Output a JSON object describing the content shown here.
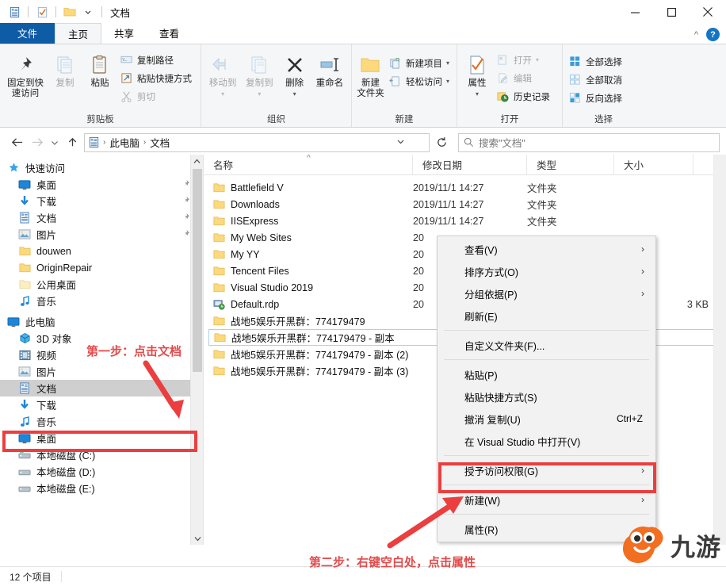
{
  "window": {
    "title": "文档",
    "minimize_label": "最小化",
    "maximize_label": "最大化",
    "close_label": "关闭",
    "help_label": "?",
    "collapse_ribbon_label": "^"
  },
  "quick_access_toolbar": [
    {
      "name": "documents-icon",
      "label": "文档"
    },
    {
      "name": "properties-icon",
      "label": "属性"
    },
    {
      "name": "new-folder-icon",
      "label": "新建文件夹"
    },
    {
      "name": "customize-icon",
      "label": "▾"
    }
  ],
  "tabs": [
    {
      "label": "文件",
      "kind": "file"
    },
    {
      "label": "主页",
      "kind": "active"
    },
    {
      "label": "共享",
      "kind": "normal"
    },
    {
      "label": "查看",
      "kind": "normal"
    }
  ],
  "ribbon": {
    "groups": [
      {
        "label": "剪贴板",
        "big": [
          {
            "label1": "固定到快",
            "label2": "速访问",
            "icon": "pin-icon",
            "dim": false
          },
          {
            "label1": "复制",
            "label2": "",
            "icon": "copy-icon",
            "dim": true
          },
          {
            "label1": "粘贴",
            "label2": "",
            "icon": "paste-icon",
            "dim": false
          }
        ],
        "small": [
          {
            "label": "复制路径",
            "icon": "copy-path-icon",
            "dim": false
          },
          {
            "label": "粘贴快捷方式",
            "icon": "paste-shortcut-icon",
            "dim": false
          },
          {
            "label": "剪切",
            "icon": "cut-icon",
            "dim": true
          }
        ]
      },
      {
        "label": "组织",
        "big": [
          {
            "label1": "移动到",
            "label2": "",
            "icon": "move-to-icon",
            "dim": true,
            "caret": true
          },
          {
            "label1": "复制到",
            "label2": "",
            "icon": "copy-to-icon",
            "dim": true,
            "caret": true
          },
          {
            "label1": "删除",
            "label2": "",
            "icon": "delete-icon",
            "dim": false,
            "caret": true
          },
          {
            "label1": "重命名",
            "label2": "",
            "icon": "rename-icon",
            "dim": false
          }
        ],
        "small": []
      },
      {
        "label": "新建",
        "big": [
          {
            "label1": "新建",
            "label2": "文件夹",
            "icon": "new-folder-icon",
            "dim": false
          }
        ],
        "small": [
          {
            "label": "新建项目",
            "icon": "new-item-icon",
            "dim": false,
            "caret": true
          },
          {
            "label": "轻松访问",
            "icon": "easy-access-icon",
            "dim": false,
            "caret": true
          }
        ]
      },
      {
        "label": "打开",
        "big": [
          {
            "label1": "属性",
            "label2": "",
            "icon": "properties-icon",
            "dim": false,
            "caret": true
          }
        ],
        "small": [
          {
            "label": "打开",
            "icon": "open-icon",
            "dim": true,
            "caret": true
          },
          {
            "label": "编辑",
            "icon": "edit-icon",
            "dim": true
          },
          {
            "label": "历史记录",
            "icon": "history-icon",
            "dim": false
          }
        ]
      },
      {
        "label": "选择",
        "big": [],
        "small": [
          {
            "label": "全部选择",
            "icon": "select-all-icon",
            "dim": false
          },
          {
            "label": "全部取消",
            "icon": "select-none-icon",
            "dim": false
          },
          {
            "label": "反向选择",
            "icon": "invert-selection-icon",
            "dim": false
          }
        ]
      }
    ]
  },
  "addressbar": {
    "back_label": "←",
    "forward_label": "→",
    "recent_label": "⌄",
    "up_label": "↑",
    "crumbs": [
      "此电脑",
      "文档"
    ],
    "dropdown_label": "⌄",
    "refresh_label": "↻"
  },
  "search": {
    "placeholder": "搜索\"文档\"",
    "icon": "search-icon"
  },
  "sidebar": {
    "items": [
      {
        "label": "快速访问",
        "icon": "quick-access-star-icon",
        "level": 0,
        "pin": false,
        "selected": false
      },
      {
        "label": "桌面",
        "icon": "desktop-icon",
        "level": 1,
        "pin": true,
        "selected": false
      },
      {
        "label": "下载",
        "icon": "downloads-icon",
        "level": 1,
        "pin": true,
        "selected": false
      },
      {
        "label": "文档",
        "icon": "documents-icon",
        "level": 1,
        "pin": true,
        "selected": false
      },
      {
        "label": "图片",
        "icon": "pictures-icon",
        "level": 1,
        "pin": true,
        "selected": false
      },
      {
        "label": "douwen",
        "icon": "folder-icon",
        "level": 1,
        "pin": false,
        "selected": false
      },
      {
        "label": "OriginRepair",
        "icon": "folder-icon",
        "level": 1,
        "pin": false,
        "selected": false
      },
      {
        "label": "公用桌面",
        "icon": "folder-icon",
        "level": 1,
        "pin": false,
        "selected": false
      },
      {
        "label": "音乐",
        "icon": "music-icon",
        "level": 1,
        "pin": false,
        "selected": false
      },
      {
        "label": "此电脑",
        "icon": "this-pc-icon",
        "level": 0,
        "pin": false,
        "selected": false
      },
      {
        "label": "3D 对象",
        "icon": "3d-objects-icon",
        "level": 1,
        "pin": false,
        "selected": false
      },
      {
        "label": "视频",
        "icon": "videos-icon",
        "level": 1,
        "pin": false,
        "selected": false
      },
      {
        "label": "图片",
        "icon": "pictures-icon",
        "level": 1,
        "pin": false,
        "selected": false
      },
      {
        "label": "文档",
        "icon": "documents-icon",
        "level": 1,
        "pin": false,
        "selected": true
      },
      {
        "label": "下载",
        "icon": "downloads-icon",
        "level": 1,
        "pin": false,
        "selected": false
      },
      {
        "label": "音乐",
        "icon": "music-icon",
        "level": 1,
        "pin": false,
        "selected": false
      },
      {
        "label": "桌面",
        "icon": "desktop-icon",
        "level": 1,
        "pin": false,
        "selected": false
      },
      {
        "label": "本地磁盘 (C:)",
        "icon": "system-drive-icon",
        "level": 1,
        "pin": false,
        "selected": false
      },
      {
        "label": "本地磁盘 (D:)",
        "icon": "drive-icon",
        "level": 1,
        "pin": false,
        "selected": false
      },
      {
        "label": "本地磁盘 (E:)",
        "icon": "drive-icon",
        "level": 1,
        "pin": false,
        "selected": false
      }
    ]
  },
  "filelist": {
    "columns": [
      {
        "label": "名称",
        "key": "name"
      },
      {
        "label": "修改日期",
        "key": "date"
      },
      {
        "label": "类型",
        "key": "type"
      },
      {
        "label": "大小",
        "key": "size"
      }
    ],
    "sort_indicator": "^",
    "rows": [
      {
        "name": "Battlefield V",
        "date": "2019/11/1 14:27",
        "type": "文件夹",
        "size": "",
        "icon": "folder-icon",
        "selected": false
      },
      {
        "name": "Downloads",
        "date": "2019/11/1 14:27",
        "type": "文件夹",
        "size": "",
        "icon": "folder-icon",
        "selected": false
      },
      {
        "name": "IISExpress",
        "date": "2019/11/1 14:27",
        "type": "文件夹",
        "size": "",
        "icon": "folder-icon",
        "selected": false
      },
      {
        "name": "My Web Sites",
        "date": "20",
        "type": "",
        "size": "",
        "icon": "folder-icon",
        "selected": false
      },
      {
        "name": "My YY",
        "date": "20",
        "type": "",
        "size": "",
        "icon": "folder-icon",
        "selected": false
      },
      {
        "name": "Tencent Files",
        "date": "20",
        "type": "",
        "size": "",
        "icon": "folder-icon",
        "selected": false
      },
      {
        "name": "Visual Studio 2019",
        "date": "20",
        "type": "",
        "size": "",
        "icon": "folder-icon",
        "selected": false
      },
      {
        "name": "Default.rdp",
        "date": "20",
        "type": "",
        "size": "3 KB",
        "icon": "rdp-file-icon",
        "selected": false
      },
      {
        "name": "战地5娱乐开黑群：774179479",
        "date": "20",
        "type": "",
        "size": "",
        "icon": "folder-icon",
        "selected": false
      },
      {
        "name": "战地5娱乐开黑群：774179479 - 副本",
        "date": "20",
        "type": "",
        "size": "",
        "icon": "folder-icon",
        "selected": true
      },
      {
        "name": "战地5娱乐开黑群：774179479 - 副本 (2)",
        "date": "20",
        "type": "",
        "size": "",
        "icon": "folder-icon",
        "selected": false
      },
      {
        "name": "战地5娱乐开黑群：774179479 - 副本 (3)",
        "date": "20",
        "type": "",
        "size": "",
        "icon": "folder-icon",
        "selected": false
      }
    ]
  },
  "context_menu": {
    "items": [
      {
        "label": "查看(V)",
        "submenu": true,
        "shortcut": "",
        "separator_after": false
      },
      {
        "label": "排序方式(O)",
        "submenu": true,
        "shortcut": "",
        "separator_after": false
      },
      {
        "label": "分组依据(P)",
        "submenu": true,
        "shortcut": "",
        "separator_after": false
      },
      {
        "label": "刷新(E)",
        "submenu": false,
        "shortcut": "",
        "separator_after": true
      },
      {
        "label": "自定义文件夹(F)...",
        "submenu": false,
        "shortcut": "",
        "separator_after": true
      },
      {
        "label": "粘贴(P)",
        "submenu": false,
        "shortcut": "",
        "separator_after": false
      },
      {
        "label": "粘贴快捷方式(S)",
        "submenu": false,
        "shortcut": "",
        "separator_after": false
      },
      {
        "label": "撤消 复制(U)",
        "submenu": false,
        "shortcut": "Ctrl+Z",
        "separator_after": false
      },
      {
        "label": "在 Visual Studio 中打开(V)",
        "submenu": false,
        "shortcut": "",
        "separator_after": true
      },
      {
        "label": "授予访问权限(G)",
        "submenu": true,
        "shortcut": "",
        "separator_after": true
      },
      {
        "label": "新建(W)",
        "submenu": true,
        "shortcut": "",
        "separator_after": true
      },
      {
        "label": "属性(R)",
        "submenu": false,
        "shortcut": "",
        "separator_after": false,
        "highlighted": true
      }
    ]
  },
  "annotations": {
    "step1": "第一步：点击文档",
    "step2": "第二步：右键空白处，点击属性",
    "color": "#e24b4b",
    "highlight_color": "#ec3e3e"
  },
  "statusbar": {
    "item_count": "12 个项目"
  },
  "watermark": {
    "text": "九游",
    "mascot": "jiuyou-mascot-icon",
    "color": "#f26e21"
  }
}
